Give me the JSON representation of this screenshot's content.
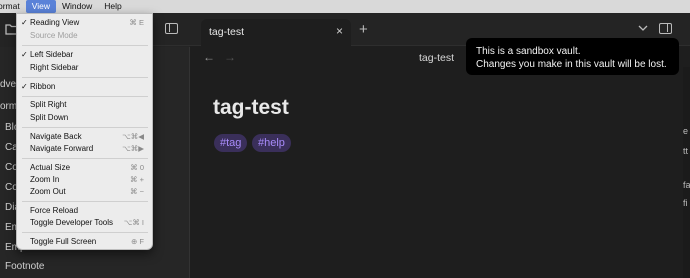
{
  "menubar": {
    "items": [
      "ormat",
      "View",
      "Window",
      "Help"
    ]
  },
  "view_menu": {
    "items": [
      {
        "label": "Reading View",
        "checked": true,
        "shortcut": "⌘ E"
      },
      {
        "label": "Source Mode",
        "disabled": true
      },
      {
        "label": "Left Sidebar",
        "checked": true
      },
      {
        "label": "Right Sidebar"
      },
      {
        "label": "Ribbon",
        "checked": true
      },
      {
        "label": "Split Right"
      },
      {
        "label": "Split Down"
      },
      {
        "label": "Navigate Back",
        "shortcut": "⌥⌘◀"
      },
      {
        "label": "Navigate Forward",
        "shortcut": "⌥⌘▶"
      },
      {
        "label": "Actual Size",
        "shortcut": "⌘ 0"
      },
      {
        "label": "Zoom In",
        "shortcut": "⌘ +"
      },
      {
        "label": "Zoom Out",
        "shortcut": "⌘ −"
      },
      {
        "label": "Force Reload"
      },
      {
        "label": "Toggle Developer Tools",
        "shortcut": "⌥⌘ I"
      },
      {
        "label": "Toggle Full Screen",
        "shortcut": "⊕ F"
      }
    ]
  },
  "sidebar": {
    "fragments": [
      "dve",
      "orm",
      "Blo",
      "Ca",
      "Co",
      "Co",
      "Dia",
      "Em",
      "Emphasis",
      "Footnote"
    ]
  },
  "tab": {
    "title": "tag-test",
    "close": "×"
  },
  "new_tab": "+",
  "view_header": {
    "title": "tag-test",
    "back": "←",
    "forward": "→"
  },
  "note": {
    "title": "tag-test",
    "tags": [
      "#tag",
      "#help"
    ]
  },
  "notice": {
    "line1": "This is a sandbox vault.",
    "line2": "Changes you make in this vault will be lost."
  },
  "right_edge_fragments": [
    "e",
    "tt",
    "fa",
    "fi"
  ],
  "colors": {
    "accent_tag": "#a88bfa",
    "tag_bg": "#3a2f5a",
    "menu_bg": "#ececec"
  }
}
